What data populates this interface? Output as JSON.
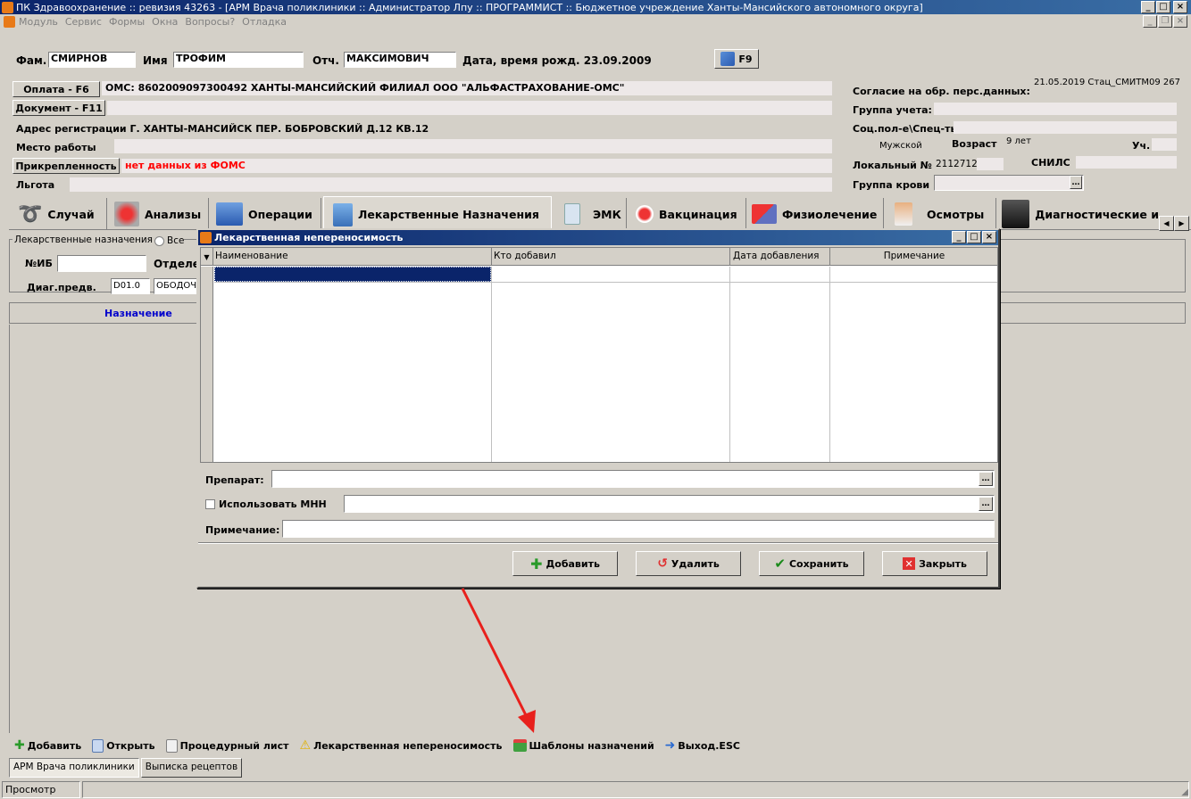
{
  "window": {
    "title": "ПК Здравоохранение :: ревизия 43263 - [АРМ Врача поликлиники :: Администратор Лпу  :: ПРОГРАММИСТ :: Бюджетное учреждение Ханты-Мансийского автономного округа]"
  },
  "menu": [
    "Модуль",
    "Сервис",
    "Формы",
    "Окна",
    "Вопросы?",
    "Отладка"
  ],
  "patient": {
    "fam_label": "Фам.",
    "fam": "СМИРНОВ",
    "imya_label": "Имя",
    "imya": "ТРОФИМ",
    "otch_label": "Отч.",
    "otch": "МАКСИМОВИЧ",
    "dob": "Дата, время рожд. 23.09.2009",
    "f9": "F9"
  },
  "info": {
    "oplata_btn": "Оплата - F6",
    "oplata_text": "ОМС:  8602009097300492 ХАНТЫ-МАНСИЙСКИЙ ФИЛИАЛ ООО \"АЛЬФАСТРАХОВАНИЕ-ОМС\"",
    "doc_btn": "Документ - F11",
    "address": "Адрес регистрации Г. ХАНТЫ-МАНСИЙСК ПЕР. БОБРОВСКИЙ Д.12  КВ.12",
    "work_label": "Место работы",
    "attach_btn": "Прикрепленность",
    "attach_text": "нет данных из ФОМС",
    "lgota_label": "Льгота"
  },
  "right": {
    "consent_label": "Согласие на обр. перс.данных:",
    "consent_value": "21.05.2019 Стац_СМИТМ09 267",
    "group_label": "Группа учета:",
    "social_label": "Соц.пол-е\\Спец-ть:  \\",
    "sex": "Мужской",
    "age_label": "Возраст",
    "age_value": "9 лет",
    "uch_label": "Уч.",
    "local_label": "Локальный №",
    "local_value": "2112712",
    "snils_label": "СНИЛС",
    "blood_label": "Группа крови"
  },
  "tabs": [
    "Случай",
    "Анализы",
    "Операции",
    "Лекарственные Назначения",
    "ЭМК",
    "Вакцинация",
    "Физиолечение",
    "Осмотры",
    "Диагностические и"
  ],
  "inner": {
    "group_label": "Лекарственные назначения",
    "radio_all": "Все",
    "nib_label": "№ИБ",
    "otdel_label": "Отделе",
    "diag_label": "Диаг.предв.",
    "diag_code": "D01.0",
    "diag_text": "ОБОДОЧ",
    "col_naznach": "Назначение"
  },
  "dialog": {
    "title": "Лекарственная непереносимость",
    "columns": [
      "Наименование",
      "Кто добавил",
      "Дата добавления",
      "Примечание"
    ],
    "preparat_label": "Препарат:",
    "mnn_label": "Использовать МНН",
    "note_label": "Примечание:",
    "btn_add": "Добавить",
    "btn_delete": "Удалить",
    "btn_save": "Сохранить",
    "btn_close": "Закрыть"
  },
  "toolbar": [
    "Добавить",
    "Открыть",
    "Процедурный лист",
    "Лекарственная непереносимость",
    "Шаблоны назначений",
    "Выход.ESC"
  ],
  "taskbar": [
    "АРМ Врача поликлиники",
    "Выписка рецептов"
  ],
  "status": "Просмотр",
  "colors": {
    "title_bar": "#0a246a",
    "alert_red": "#ff0000",
    "arrow": "#e8201c",
    "link_blue": "#0000cc"
  }
}
